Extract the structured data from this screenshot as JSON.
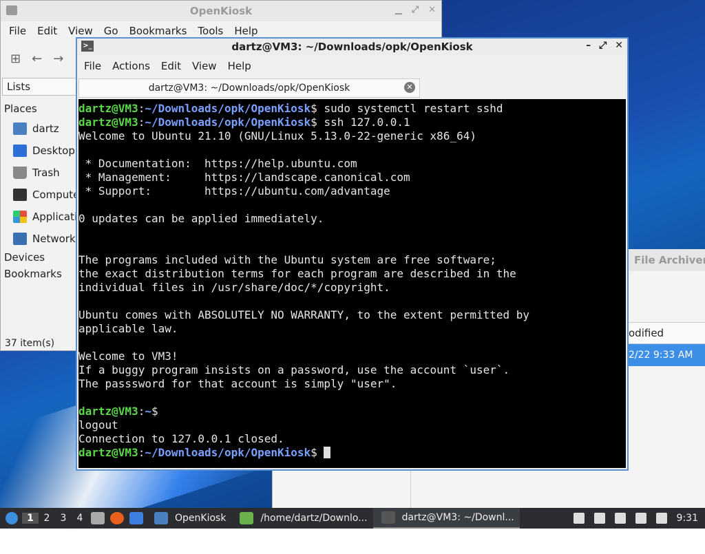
{
  "file_manager": {
    "title": "OpenKiosk",
    "menu": [
      "File",
      "Edit",
      "View",
      "Go",
      "Bookmarks",
      "Tools",
      "Help"
    ],
    "lists_label": "Lists",
    "places_header": "Places",
    "places": [
      "dartz",
      "Desktop",
      "Trash",
      "Computer",
      "Applications",
      "Network"
    ],
    "devices_header": "Devices",
    "bookmarks_header": "Bookmarks",
    "status": "37 item(s)"
  },
  "file_archiver": {
    "title": "File Archiver",
    "column": "odified",
    "row_date": "2/22 9:33 AM"
  },
  "terminal": {
    "title": "dartz@VM3: ~/Downloads/opk/OpenKiosk",
    "menu": [
      "File",
      "Actions",
      "Edit",
      "View",
      "Help"
    ],
    "tab_label": "dartz@VM3: ~/Downloads/opk/OpenKiosk",
    "user": "dartz@VM3",
    "path_long": "~/Downloads/opk/OpenKiosk",
    "path_home": "~",
    "cmd1": " sudo systemctl restart sshd",
    "cmd2": " ssh 127.0.0.1",
    "output": [
      "Welcome to Ubuntu 21.10 (GNU/Linux 5.13.0-22-generic x86_64)",
      "",
      " * Documentation:  https://help.ubuntu.com",
      " * Management:     https://landscape.canonical.com",
      " * Support:        https://ubuntu.com/advantage",
      "",
      "0 updates can be applied immediately.",
      "",
      "",
      "The programs included with the Ubuntu system are free software;",
      "the exact distribution terms for each program are described in the",
      "individual files in /usr/share/doc/*/copyright.",
      "",
      "Ubuntu comes with ABSOLUTELY NO WARRANTY, to the extent permitted by",
      "applicable law.",
      "",
      "Welcome to VM3!",
      "If a buggy program insists on a password, use the account `user`.",
      "The passsword for that account is simply \"user\".",
      ""
    ],
    "after_logout": [
      "logout",
      "Connection to 127.0.0.1 closed."
    ]
  },
  "taskbar": {
    "workspaces": [
      "1",
      "2",
      "3",
      "4"
    ],
    "tasks": [
      "OpenKiosk",
      "/home/dartz/Downlo...",
      "dartz@VM3: ~/Downl..."
    ],
    "clock": "9:31"
  }
}
